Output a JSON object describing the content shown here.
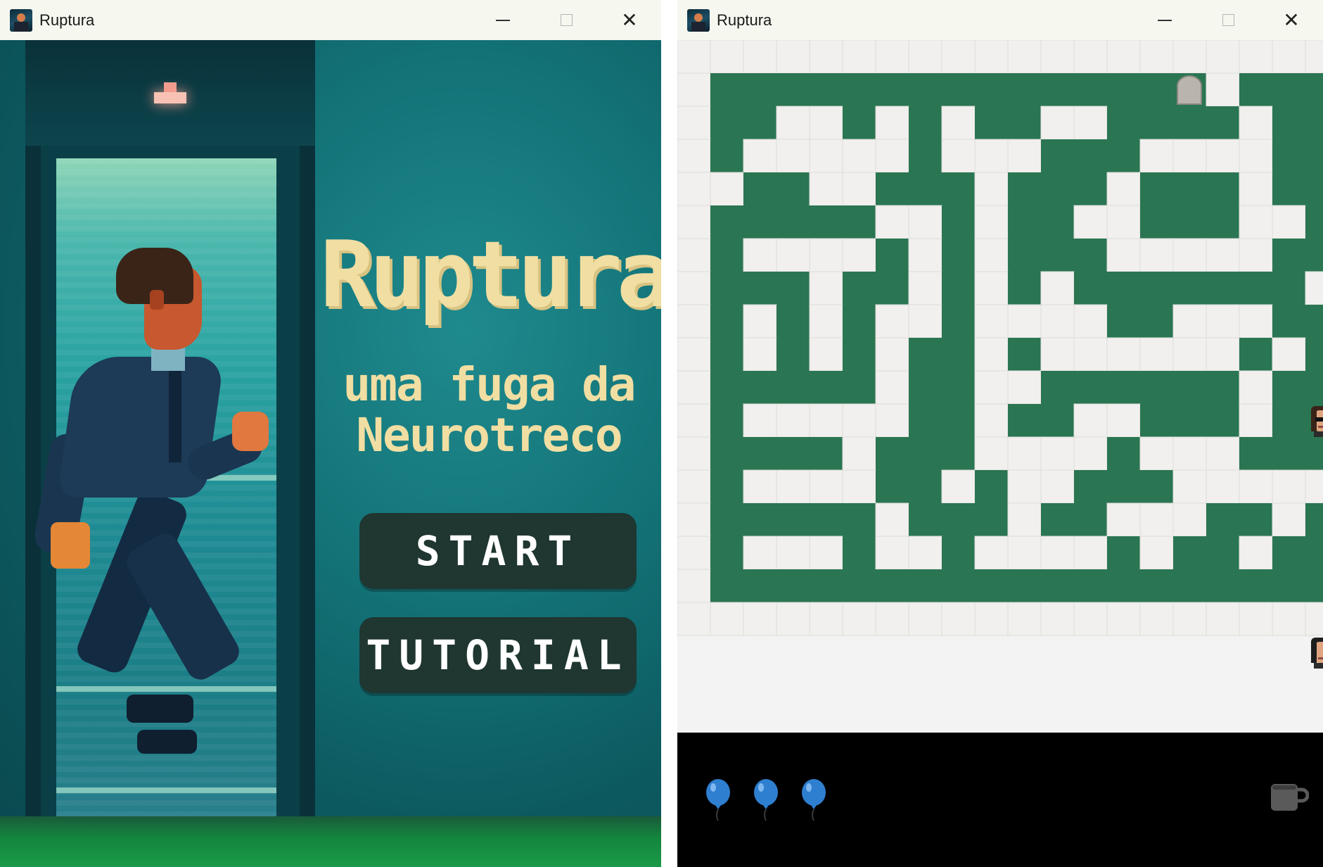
{
  "windows": [
    {
      "title": "Ruptura",
      "screen": "title",
      "game_title": "Ruptura",
      "subtitle_line1": "uma fuga da",
      "subtitle_line2": "Neurotreco",
      "buttons": {
        "start": "START",
        "tutorial": "TUTORIAL"
      }
    },
    {
      "title": "Ruptura",
      "screen": "maze",
      "maze": {
        "cols": 20,
        "rows": 21,
        "grid": [
          "00000000000000000000",
          "01111111111111110111",
          "01100101011001111011",
          "01000001000111000011",
          "00110011101110111011",
          "01111100101100111001",
          "01000010101110000011",
          "01110110101011111110",
          "01010100100001100011",
          "01010101101000000101",
          "01111101100111111011",
          "01000001101100111011",
          "01111011100001000111",
          "01000011010011100000",
          "01111101110110001101",
          "01000100100001011011",
          "01111111111111111111",
          "00000000000000000000",
          "00000000000000000000",
          "00000000000000000000",
          "00000000000000000000"
        ],
        "wall_color": "#2a7552",
        "floor_color": "#f1f0ee",
        "grid_color": "#dcdcd8",
        "tombstone_cell": [
          1,
          15
        ],
        "player_cell": [
          11,
          19
        ],
        "guard_cell": [
          18,
          19
        ]
      },
      "hud": {
        "lives": 3,
        "life_icon": "blue-balloon-icon",
        "life_color": "#2f7fd0",
        "item_icon": "coffee-mug-icon"
      }
    }
  ],
  "icons": {
    "window_close": "✕",
    "window_minimize": "minimize-icon",
    "window_maximize": "maximize-icon"
  }
}
